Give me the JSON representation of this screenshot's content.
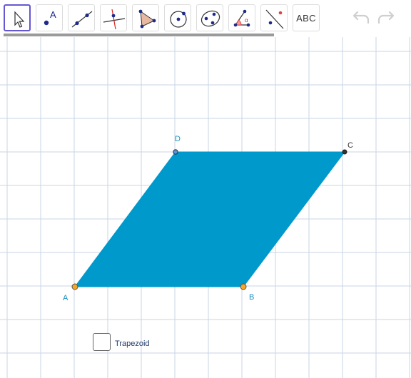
{
  "toolbar": {
    "tools": [
      {
        "name": "move-tool-button",
        "icon": "cursor-arrow-icon",
        "selected": true
      },
      {
        "name": "point-tool-button",
        "icon": "point-with-label-icon",
        "selected": false,
        "label": "A"
      },
      {
        "name": "line-tool-button",
        "icon": "line-through-points-icon",
        "selected": false
      },
      {
        "name": "perpendicular-line-tool-button",
        "icon": "perpendicular-line-icon",
        "selected": false
      },
      {
        "name": "polygon-tool-button",
        "icon": "polygon-triangle-icon",
        "selected": false
      },
      {
        "name": "circle-tool-button",
        "icon": "circle-center-point-icon",
        "selected": false
      },
      {
        "name": "conic-tool-button",
        "icon": "ellipse-through-points-icon",
        "selected": false
      },
      {
        "name": "angle-tool-button",
        "icon": "angle-measure-icon",
        "selected": false,
        "label": "α"
      },
      {
        "name": "reflect-tool-button",
        "icon": "reflect-about-line-icon",
        "selected": false
      },
      {
        "name": "text-tool-button",
        "icon": "text-abc-icon",
        "selected": false,
        "label": "ABC"
      }
    ],
    "undo_icon": "undo-icon",
    "redo_icon": "redo-icon"
  },
  "points": {
    "A": {
      "label": "A"
    },
    "B": {
      "label": "B"
    },
    "C": {
      "label": "C"
    },
    "D": {
      "label": "D"
    }
  },
  "checkbox": {
    "label": "Trapezoid",
    "checked": false
  },
  "colors": {
    "polygon_fill": "#0099cc",
    "point_free": "#f5a623",
    "point_fixed": "#333333",
    "point_blue": "#5b8fd6",
    "grid_line": "#c8d6e5",
    "selection": "#6557d2"
  }
}
